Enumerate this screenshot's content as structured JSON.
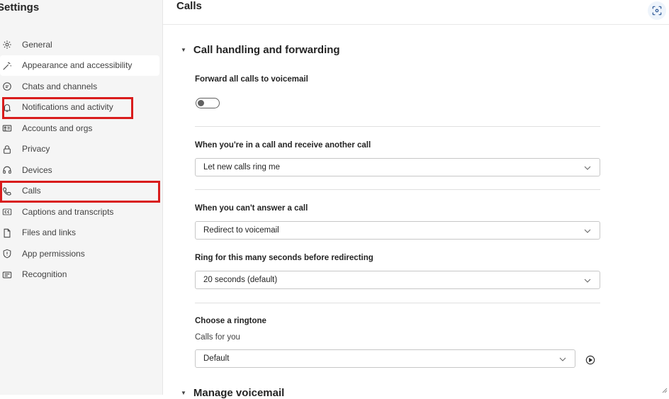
{
  "sidebar": {
    "title": "Settings",
    "items": [
      {
        "label": "General",
        "icon": "gear-icon"
      },
      {
        "label": "Appearance and accessibility",
        "icon": "magic-wand-icon"
      },
      {
        "label": "Chats and channels",
        "icon": "chat-bubble-icon"
      },
      {
        "label": "Notifications and activity",
        "icon": "bell-icon"
      },
      {
        "label": "Accounts and orgs",
        "icon": "id-card-icon"
      },
      {
        "label": "Privacy",
        "icon": "lock-icon"
      },
      {
        "label": "Devices",
        "icon": "headset-icon"
      },
      {
        "label": "Calls",
        "icon": "phone-icon"
      },
      {
        "label": "Captions and transcripts",
        "icon": "closed-caption-icon"
      },
      {
        "label": "Files and links",
        "icon": "document-icon"
      },
      {
        "label": "App permissions",
        "icon": "shield-icon"
      },
      {
        "label": "Recognition",
        "icon": "recognition-icon"
      }
    ]
  },
  "header": {
    "title": "Calls",
    "action_icon": "scan-icon"
  },
  "main": {
    "section_title": "Call handling and forwarding",
    "forward_voicemail": {
      "label": "Forward all calls to voicemail",
      "toggle_on": false
    },
    "in_call": {
      "label": "When you're in a call and receive another call",
      "value": "Let new calls ring me"
    },
    "cant_answer": {
      "label": "When you can't answer a call",
      "value": "Redirect to voicemail"
    },
    "ring_seconds": {
      "label": "Ring for this many seconds before redirecting",
      "value": "20 seconds (default)"
    },
    "ringtone": {
      "label": "Choose a ringtone",
      "sublabel": "Calls for you",
      "value": "Default"
    },
    "next_section_title": "Manage voicemail"
  },
  "colors": {
    "highlight_box": "#d91c1c",
    "accent": "#5b5fc7"
  }
}
